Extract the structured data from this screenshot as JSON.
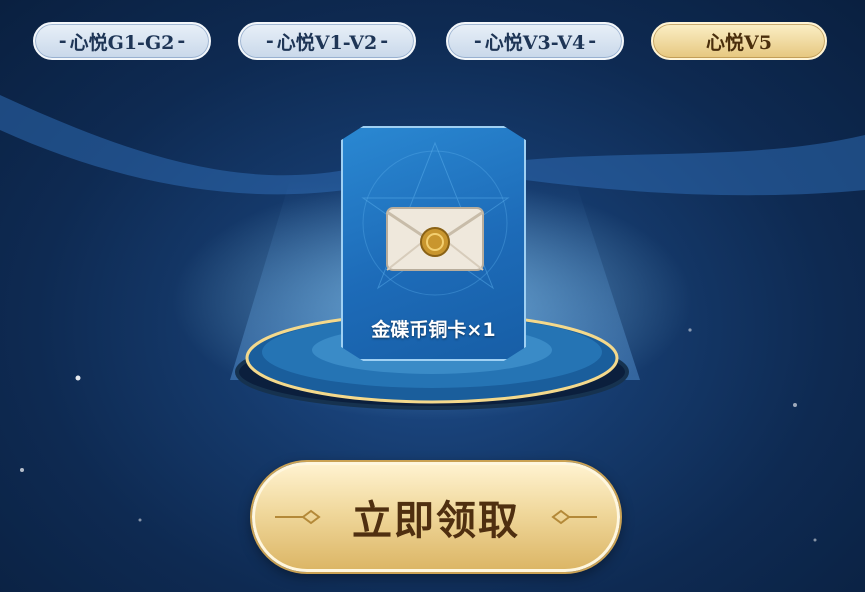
{
  "tabs": [
    {
      "label": "心悦G1-G2",
      "active": false
    },
    {
      "label": "心悦V1-V2",
      "active": false
    },
    {
      "label": "心悦V3-V4",
      "active": false
    },
    {
      "label": "心悦V5",
      "active": true
    }
  ],
  "reward": {
    "label": "金碟币铜卡×1",
    "icon": "envelope-icon"
  },
  "claim_button": {
    "label": "立即领取"
  },
  "colors": {
    "background": "#12335f",
    "tab_inactive": "#d7e3f0",
    "tab_active": "#edd391",
    "card": "#2379c6",
    "button": "#f0d89c"
  }
}
